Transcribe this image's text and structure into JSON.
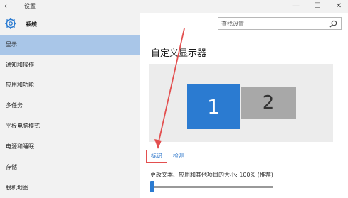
{
  "window": {
    "title": "设置",
    "back": "←",
    "minimize": "—",
    "maximize": "☐",
    "close": "✕"
  },
  "sidebar": {
    "title": "系统",
    "items": [
      {
        "label": "显示",
        "active": true
      },
      {
        "label": "通知和操作",
        "active": false
      },
      {
        "label": "应用和功能",
        "active": false
      },
      {
        "label": "多任务",
        "active": false
      },
      {
        "label": "平板电脑模式",
        "active": false
      },
      {
        "label": "电源和睡眠",
        "active": false
      },
      {
        "label": "存储",
        "active": false
      },
      {
        "label": "脱机地图",
        "active": false
      }
    ]
  },
  "search": {
    "placeholder": "查找设置"
  },
  "main": {
    "title": "自定义显示器",
    "monitors": [
      "1",
      "2"
    ],
    "identify_label": "标识",
    "detect_label": "检测",
    "scale_label": "更改文本、应用和其他项目的大小: 100% (推荐)",
    "scale_level": 0.0
  },
  "colors": {
    "accent": "#2b7bd1",
    "active_nav": "#a9c6e8",
    "annotation": "#e34f4f"
  }
}
